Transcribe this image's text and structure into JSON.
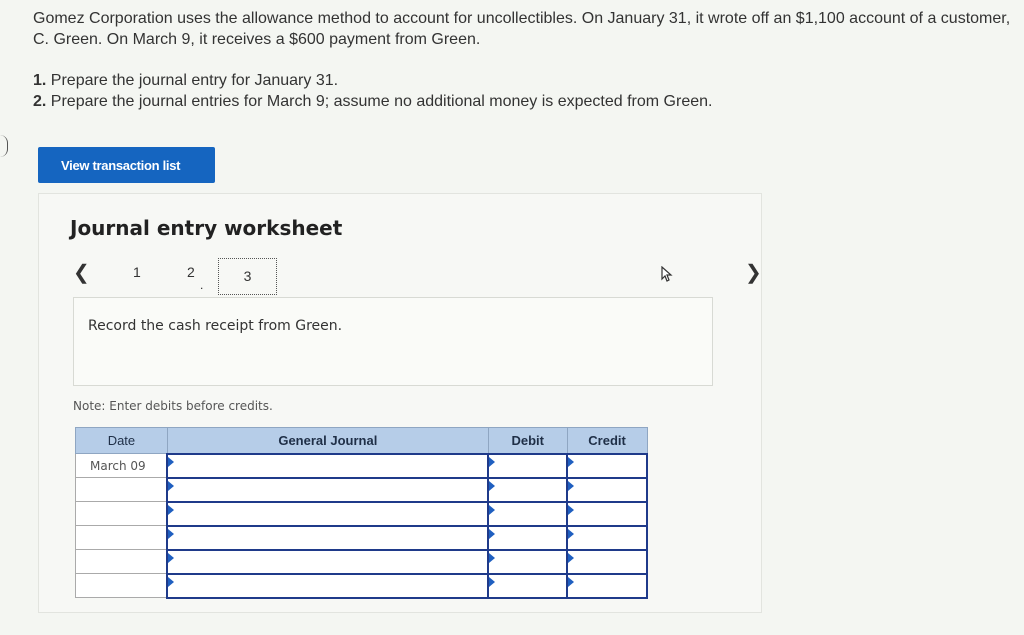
{
  "problem": {
    "text": "Gomez Corporation uses the allowance method to account for uncollectibles. On January 31, it wrote off an $1,100 account of a customer, C. Green. On March 9, it receives a $600 payment from Green."
  },
  "steps": [
    {
      "num": "1.",
      "text": "Prepare the journal entry for January 31."
    },
    {
      "num": "2.",
      "text": "Prepare the journal entries for March 9; assume no additional money is expected from Green."
    }
  ],
  "view_button_label": "View transaction list",
  "worksheet": {
    "title": "Journal entry worksheet",
    "pages": [
      "1",
      "2",
      "3"
    ],
    "instruction": "Record the cash receipt from Green.",
    "note": "Note: Enter debits before credits."
  },
  "journal": {
    "headers": {
      "date": "Date",
      "general_journal": "General Journal",
      "debit": "Debit",
      "credit": "Credit"
    },
    "rows": [
      {
        "date": "March 09"
      },
      {
        "date": ""
      },
      {
        "date": ""
      },
      {
        "date": ""
      },
      {
        "date": ""
      },
      {
        "date": ""
      }
    ]
  },
  "icons": {
    "prev": "chevron-left-icon",
    "next": "chevron-right-icon",
    "cursor": "mouse-pointer-icon"
  },
  "colors": {
    "button": "#1565c0",
    "header": "#b6cde8",
    "entry_border": "#1f3a8a"
  }
}
